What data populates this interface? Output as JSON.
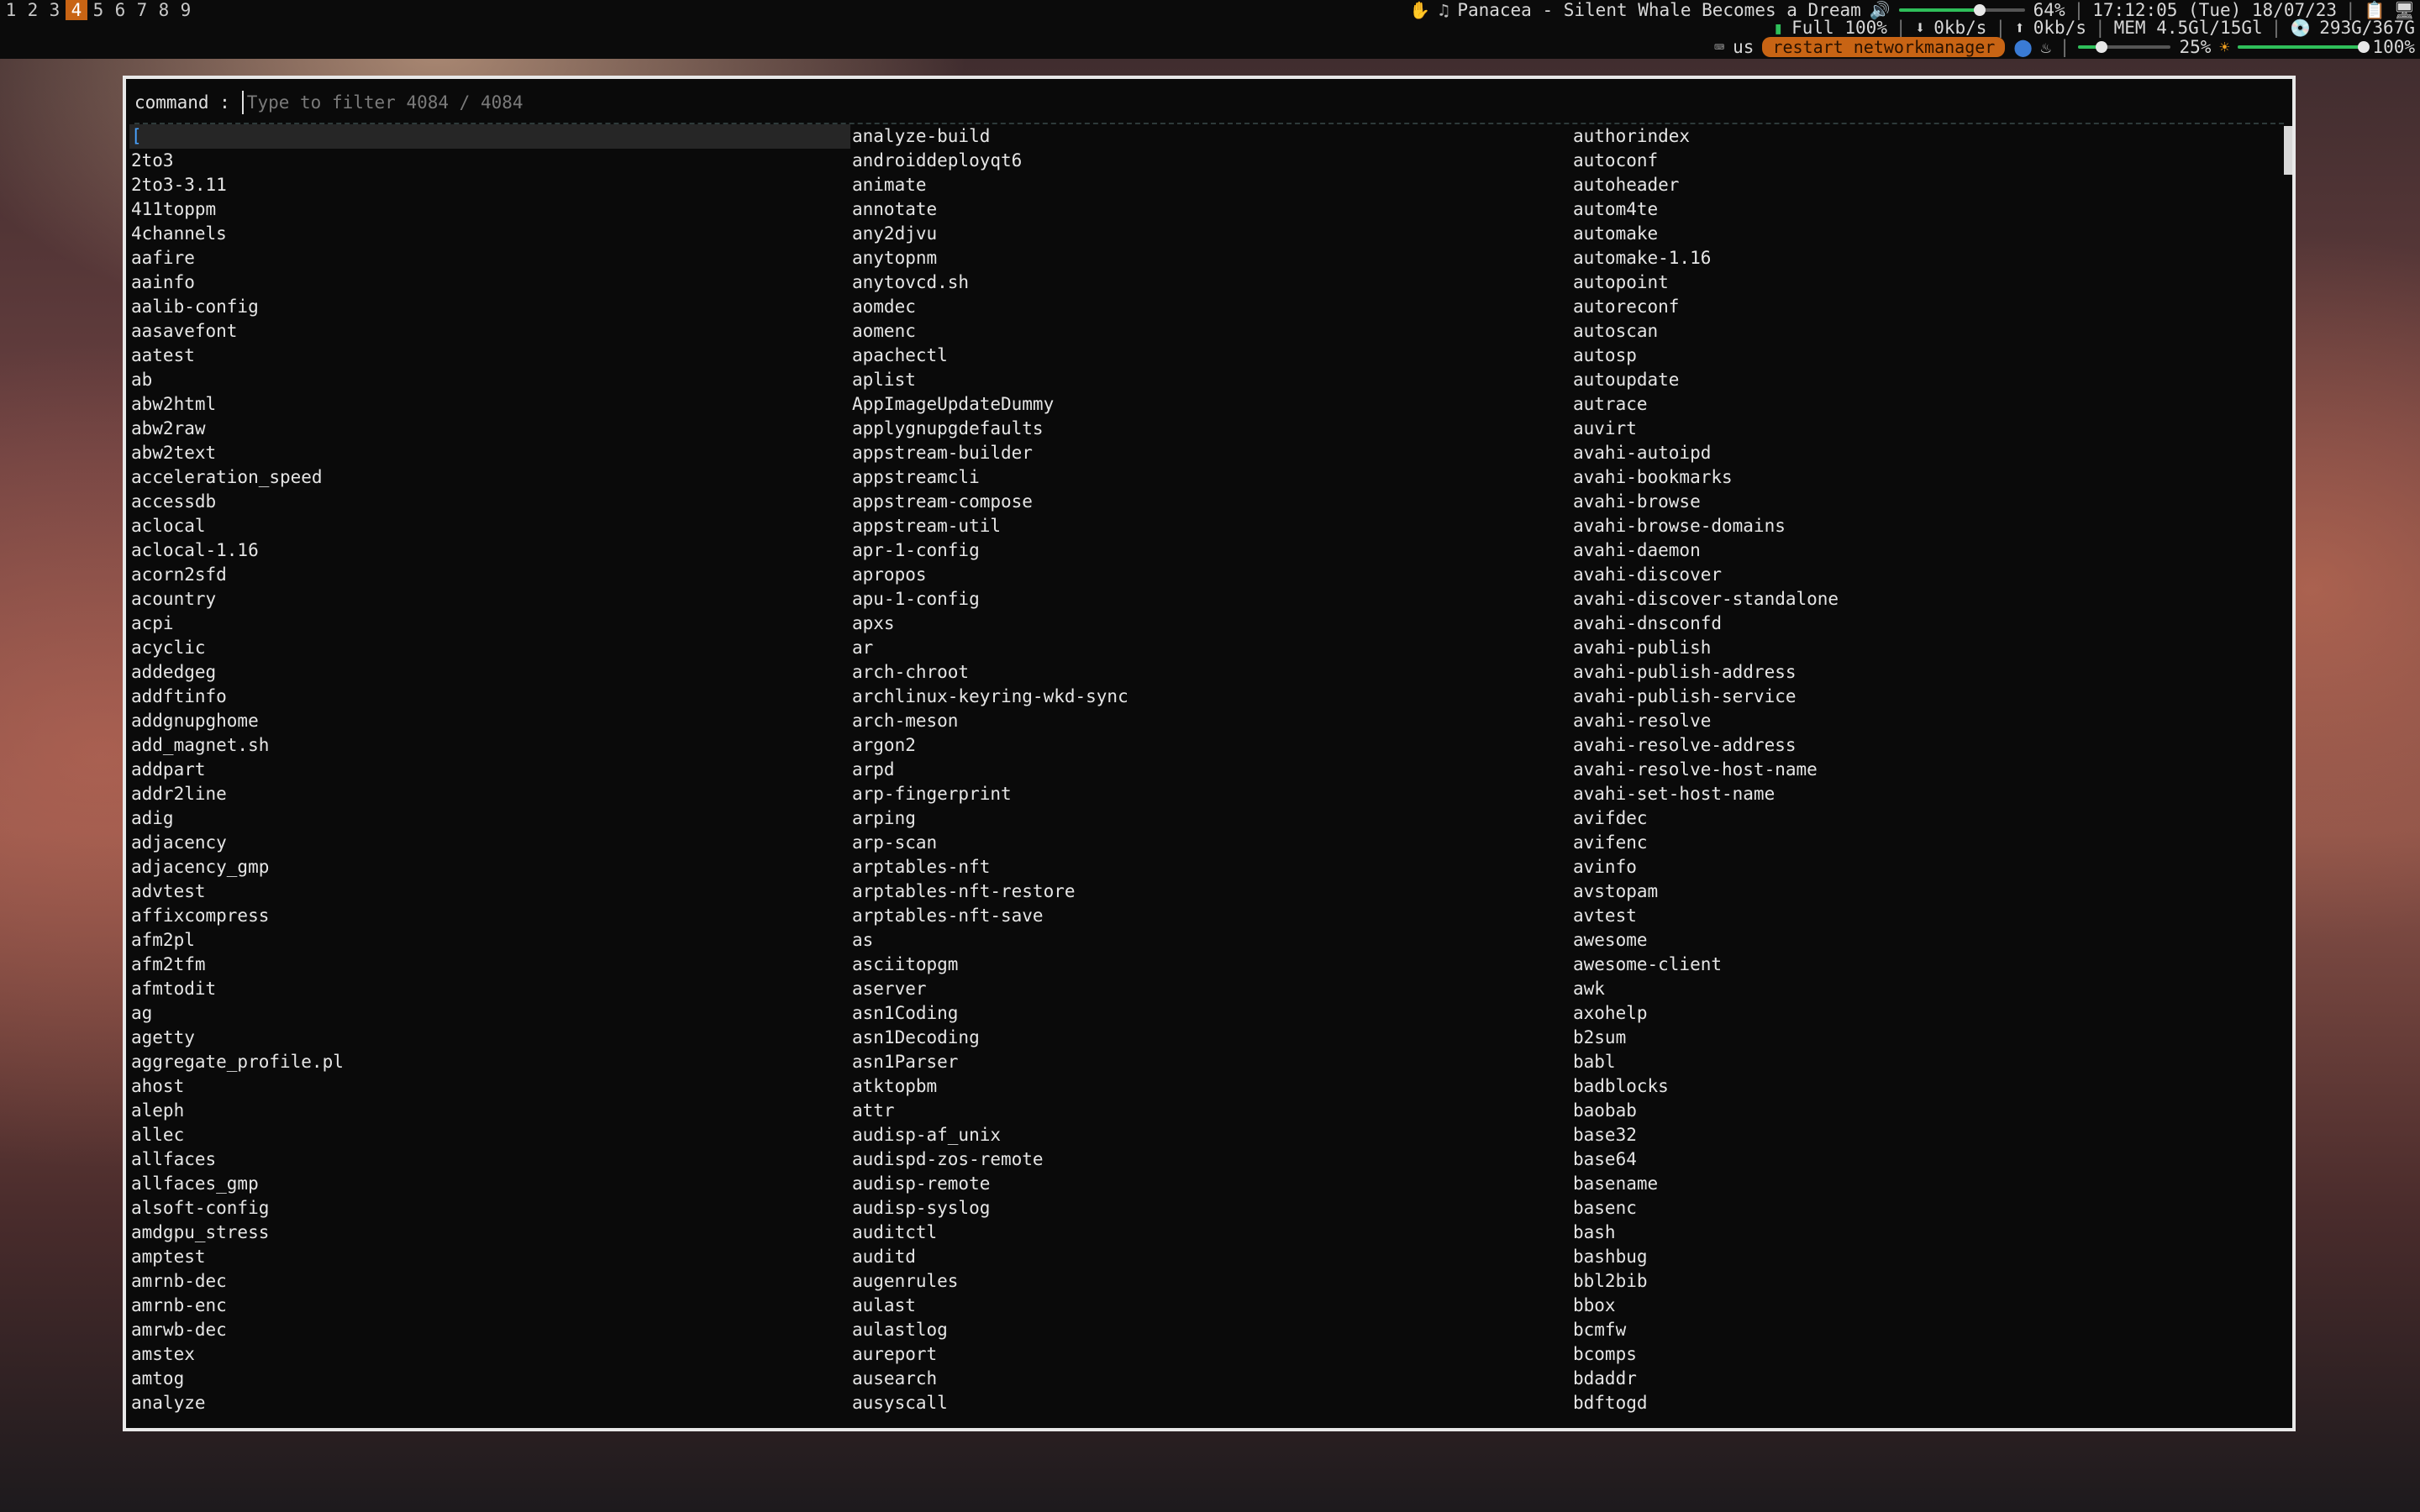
{
  "topbar": {
    "workspaces": [
      "1",
      "2",
      "3",
      "4",
      "5",
      "6",
      "7",
      "8",
      "9"
    ],
    "active_workspace": "4",
    "now_playing": "Panacea - Silent Whale Becomes a Dream",
    "volume_percent": "64%",
    "volume_level": 0.64,
    "clock": "17:12:05 (Tue) 18/07/23",
    "battery": "Full 100%",
    "net_down": "0kb/s",
    "net_up": "0kb/s",
    "memory": "MEM 4.5Gl/15Gl",
    "disk": "293G/367G",
    "keyboard_layout": "us",
    "network_button": "restart networkmanager",
    "mic_percent": "25%",
    "mic_level": 0.25,
    "brightness_percent": "100%",
    "brightness_level": 1.0,
    "accent_color": "#c86414"
  },
  "launcher": {
    "prompt": "command :",
    "placeholder": "Type to filter 4084 / 4084",
    "selected_index": 0,
    "columns": [
      [
        "[",
        "2to3",
        "2to3-3.11",
        "411toppm",
        "4channels",
        "aafire",
        "aainfo",
        "aalib-config",
        "aasavefont",
        "aatest",
        "ab",
        "abw2html",
        "abw2raw",
        "abw2text",
        "acceleration_speed",
        "accessdb",
        "aclocal",
        "aclocal-1.16",
        "acorn2sfd",
        "acountry",
        "acpi",
        "acyclic",
        "addedgeg",
        "addftinfo",
        "addgnupghome",
        "add_magnet.sh",
        "addpart",
        "addr2line",
        "adig",
        "adjacency",
        "adjacency_gmp",
        "advtest",
        "affixcompress",
        "afm2pl",
        "afm2tfm",
        "afmtodit",
        "ag",
        "agetty",
        "aggregate_profile.pl",
        "ahost",
        "aleph",
        "allec",
        "allfaces",
        "allfaces_gmp",
        "alsoft-config",
        "amdgpu_stress",
        "amptest",
        "amrnb-dec",
        "amrnb-enc",
        "amrwb-dec",
        "amstex",
        "amtog",
        "analyze"
      ],
      [
        "analyze-build",
        "androiddeployqt6",
        "animate",
        "annotate",
        "any2djvu",
        "anytopnm",
        "anytovcd.sh",
        "aomdec",
        "aomenc",
        "apachectl",
        "aplist",
        "AppImageUpdateDummy",
        "applygnupgdefaults",
        "appstream-builder",
        "appstreamcli",
        "appstream-compose",
        "appstream-util",
        "apr-1-config",
        "apropos",
        "apu-1-config",
        "apxs",
        "ar",
        "arch-chroot",
        "archlinux-keyring-wkd-sync",
        "arch-meson",
        "argon2",
        "arpd",
        "arp-fingerprint",
        "arping",
        "arp-scan",
        "arptables-nft",
        "arptables-nft-restore",
        "arptables-nft-save",
        "as",
        "asciitopgm",
        "aserver",
        "asn1Coding",
        "asn1Decoding",
        "asn1Parser",
        "atktopbm",
        "attr",
        "audisp-af_unix",
        "audispd-zos-remote",
        "audisp-remote",
        "audisp-syslog",
        "auditctl",
        "auditd",
        "augenrules",
        "aulast",
        "aulastlog",
        "aureport",
        "ausearch",
        "ausyscall"
      ],
      [
        "authorindex",
        "autoconf",
        "autoheader",
        "autom4te",
        "automake",
        "automake-1.16",
        "autopoint",
        "autoreconf",
        "autoscan",
        "autosp",
        "autoupdate",
        "autrace",
        "auvirt",
        "avahi-autoipd",
        "avahi-bookmarks",
        "avahi-browse",
        "avahi-browse-domains",
        "avahi-daemon",
        "avahi-discover",
        "avahi-discover-standalone",
        "avahi-dnsconfd",
        "avahi-publish",
        "avahi-publish-address",
        "avahi-publish-service",
        "avahi-resolve",
        "avahi-resolve-address",
        "avahi-resolve-host-name",
        "avahi-set-host-name",
        "avifdec",
        "avifenc",
        "avinfo",
        "avstopam",
        "avtest",
        "awesome",
        "awesome-client",
        "awk",
        "axohelp",
        "b2sum",
        "babl",
        "badblocks",
        "baobab",
        "base32",
        "base64",
        "basename",
        "basenc",
        "bash",
        "bashbug",
        "bbl2bib",
        "bbox",
        "bcmfw",
        "bcomps",
        "bdaddr",
        "bdftogd"
      ]
    ]
  }
}
